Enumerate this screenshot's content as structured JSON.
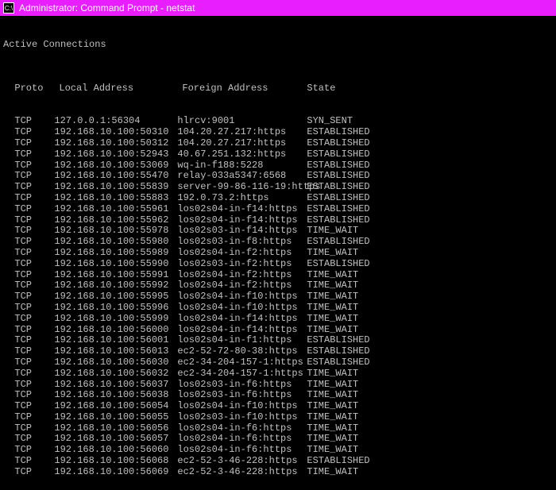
{
  "window": {
    "title": "Administrator: Command Prompt - netstat",
    "icon": "cmd-icon"
  },
  "output": {
    "heading": "Active Connections",
    "columns": {
      "proto": "Proto",
      "local": "Local Address",
      "foreign": "Foreign Address",
      "state": "State"
    },
    "rows": [
      {
        "proto": "TCP",
        "local": "127.0.0.1:56304",
        "foreign": "hlrcv:9001",
        "state": "SYN_SENT"
      },
      {
        "proto": "TCP",
        "local": "192.168.10.100:50310",
        "foreign": "104.20.27.217:https",
        "state": "ESTABLISHED"
      },
      {
        "proto": "TCP",
        "local": "192.168.10.100:50312",
        "foreign": "104.20.27.217:https",
        "state": "ESTABLISHED"
      },
      {
        "proto": "TCP",
        "local": "192.168.10.100:52943",
        "foreign": "40.67.251.132:https",
        "state": "ESTABLISHED"
      },
      {
        "proto": "TCP",
        "local": "192.168.10.100:53069",
        "foreign": "wq-in-f188:5228",
        "state": "ESTABLISHED"
      },
      {
        "proto": "TCP",
        "local": "192.168.10.100:55470",
        "foreign": "relay-033a5347:6568",
        "state": "ESTABLISHED"
      },
      {
        "proto": "TCP",
        "local": "192.168.10.100:55839",
        "foreign": "server-99-86-116-19:https",
        "state": "ESTABLISHED"
      },
      {
        "proto": "TCP",
        "local": "192.168.10.100:55883",
        "foreign": "192.0.73.2:https",
        "state": "ESTABLISHED"
      },
      {
        "proto": "TCP",
        "local": "192.168.10.100:55961",
        "foreign": "los02s04-in-f14:https",
        "state": "ESTABLISHED"
      },
      {
        "proto": "TCP",
        "local": "192.168.10.100:55962",
        "foreign": "los02s04-in-f14:https",
        "state": "ESTABLISHED"
      },
      {
        "proto": "TCP",
        "local": "192.168.10.100:55978",
        "foreign": "los02s03-in-f14:https",
        "state": "TIME_WAIT"
      },
      {
        "proto": "TCP",
        "local": "192.168.10.100:55980",
        "foreign": "los02s03-in-f8:https",
        "state": "ESTABLISHED"
      },
      {
        "proto": "TCP",
        "local": "192.168.10.100:55989",
        "foreign": "los02s04-in-f2:https",
        "state": "TIME_WAIT"
      },
      {
        "proto": "TCP",
        "local": "192.168.10.100:55990",
        "foreign": "los02s03-in-f2:https",
        "state": "ESTABLISHED"
      },
      {
        "proto": "TCP",
        "local": "192.168.10.100:55991",
        "foreign": "los02s04-in-f2:https",
        "state": "TIME_WAIT"
      },
      {
        "proto": "TCP",
        "local": "192.168.10.100:55992",
        "foreign": "los02s04-in-f2:https",
        "state": "TIME_WAIT"
      },
      {
        "proto": "TCP",
        "local": "192.168.10.100:55995",
        "foreign": "los02s04-in-f10:https",
        "state": "TIME_WAIT"
      },
      {
        "proto": "TCP",
        "local": "192.168.10.100:55996",
        "foreign": "los02s04-in-f10:https",
        "state": "TIME_WAIT"
      },
      {
        "proto": "TCP",
        "local": "192.168.10.100:55999",
        "foreign": "los02s04-in-f14:https",
        "state": "TIME_WAIT"
      },
      {
        "proto": "TCP",
        "local": "192.168.10.100:56000",
        "foreign": "los02s04-in-f14:https",
        "state": "TIME_WAIT"
      },
      {
        "proto": "TCP",
        "local": "192.168.10.100:56001",
        "foreign": "los02s04-in-f1:https",
        "state": "ESTABLISHED"
      },
      {
        "proto": "TCP",
        "local": "192.168.10.100:56013",
        "foreign": "ec2-52-72-80-38:https",
        "state": "ESTABLISHED"
      },
      {
        "proto": "TCP",
        "local": "192.168.10.100:56030",
        "foreign": "ec2-34-204-157-1:https",
        "state": "ESTABLISHED"
      },
      {
        "proto": "TCP",
        "local": "192.168.10.100:56032",
        "foreign": "ec2-34-204-157-1:https",
        "state": "TIME_WAIT"
      },
      {
        "proto": "TCP",
        "local": "192.168.10.100:56037",
        "foreign": "los02s03-in-f6:https",
        "state": "TIME_WAIT"
      },
      {
        "proto": "TCP",
        "local": "192.168.10.100:56038",
        "foreign": "los02s03-in-f6:https",
        "state": "TIME_WAIT"
      },
      {
        "proto": "TCP",
        "local": "192.168.10.100:56054",
        "foreign": "los02s04-in-f10:https",
        "state": "TIME_WAIT"
      },
      {
        "proto": "TCP",
        "local": "192.168.10.100:56055",
        "foreign": "los02s03-in-f10:https",
        "state": "TIME_WAIT"
      },
      {
        "proto": "TCP",
        "local": "192.168.10.100:56056",
        "foreign": "los02s04-in-f6:https",
        "state": "TIME_WAIT"
      },
      {
        "proto": "TCP",
        "local": "192.168.10.100:56057",
        "foreign": "los02s04-in-f6:https",
        "state": "TIME_WAIT"
      },
      {
        "proto": "TCP",
        "local": "192.168.10.100:56060",
        "foreign": "los02s04-in-f6:https",
        "state": "TIME_WAIT"
      },
      {
        "proto": "TCP",
        "local": "192.168.10.100:56068",
        "foreign": "ec2-52-3-46-228:https",
        "state": "ESTABLISHED"
      },
      {
        "proto": "TCP",
        "local": "192.168.10.100:56069",
        "foreign": "ec2-52-3-46-228:https",
        "state": "TIME_WAIT"
      }
    ]
  }
}
